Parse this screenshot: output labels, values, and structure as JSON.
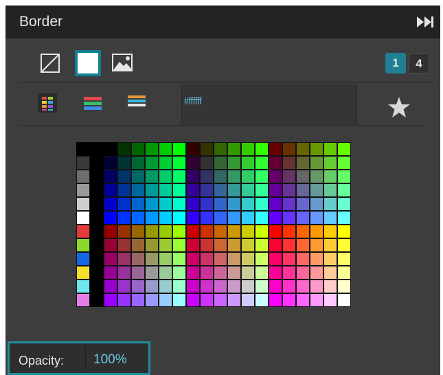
{
  "panel": {
    "title": "Border"
  },
  "border_styles": [
    {
      "name": "no-border",
      "selected": false
    },
    {
      "name": "solid-border",
      "selected": true
    },
    {
      "name": "image-border",
      "selected": false
    }
  ],
  "layers": [
    {
      "label": "1",
      "selected": true
    },
    {
      "label": "4",
      "selected": false
    }
  ],
  "swatch_modes": [
    {
      "icon": "grid-palette-icon",
      "selected": true
    },
    {
      "icon": "stripes-palette-icon",
      "selected": false
    },
    {
      "icon": "slider-palette-icon",
      "selected": false
    }
  ],
  "color": {
    "hex": "#ffffff"
  },
  "opacity": {
    "label": "Opacity:",
    "value": "100%"
  },
  "colors": {
    "accent": "#1f8fa0",
    "panel_bg": "#3d3d3d",
    "header_bg": "#232323",
    "text": "#e6e6e6",
    "hex_text": "#64c8e6"
  }
}
